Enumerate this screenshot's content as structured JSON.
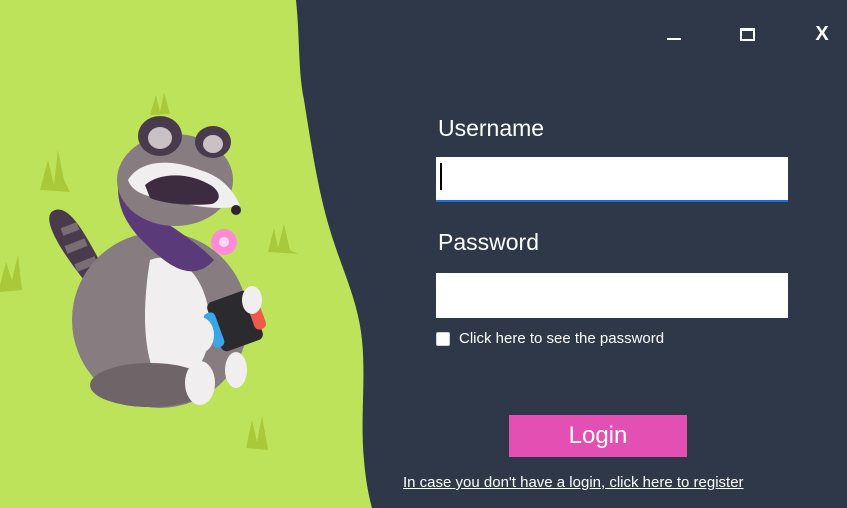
{
  "window": {
    "controls": {
      "minimize_icon": "minimize-icon",
      "maximize_icon": "maximize-icon",
      "close_label": "X"
    }
  },
  "illustration": {
    "subject": "raccoon-icon",
    "background_color": "#bde35a"
  },
  "form": {
    "username_label": "Username",
    "username_value": "",
    "password_label": "Password",
    "password_value": "",
    "show_password_label": "Click here to see the password",
    "show_password_checked": false
  },
  "actions": {
    "login_label": "Login",
    "register_link": "In case you don't have a login, click here to register"
  },
  "colors": {
    "panel_background": "#2f3849",
    "accent_pink": "#e34fb2",
    "input_focus_underline": "#1f6fd6",
    "text": "#ffffff"
  }
}
